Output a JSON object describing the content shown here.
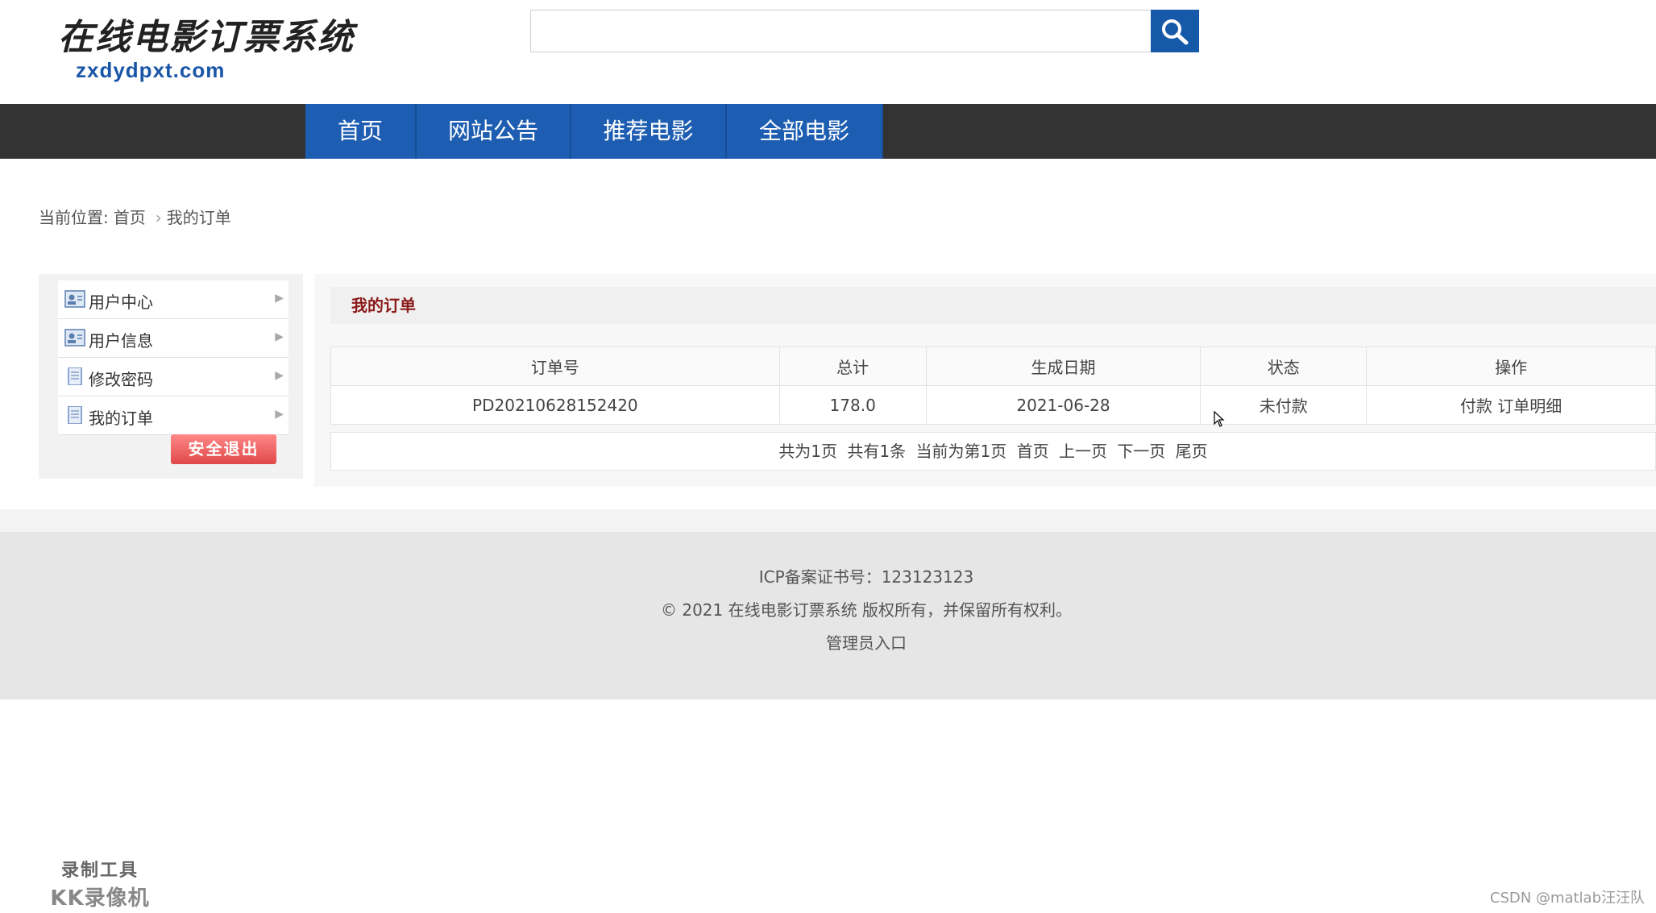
{
  "header": {
    "logo_cn": "在线电影订票系统",
    "logo_en": "zxdydpxt.com",
    "search": {
      "placeholder": "",
      "value": ""
    }
  },
  "nav": {
    "items": [
      "首页",
      "网站公告",
      "推荐电影",
      "全部电影"
    ]
  },
  "breadcrumb": {
    "prefix": "当前位置:",
    "home": "首页",
    "current": "我的订单"
  },
  "sidebar": {
    "items": [
      {
        "label": "用户中心",
        "icon": "user-card-icon"
      },
      {
        "label": "用户信息",
        "icon": "user-card-icon"
      },
      {
        "label": "修改密码",
        "icon": "document-icon"
      },
      {
        "label": "我的订单",
        "icon": "document-icon"
      }
    ],
    "logout_label": "安全退出"
  },
  "main": {
    "title": "我的订单",
    "table": {
      "headers": [
        "订单号",
        "总计",
        "生成日期",
        "状态",
        "操作"
      ],
      "rows": [
        {
          "order_no": "PD20210628152420",
          "total": "178.0",
          "date": "2021-06-28",
          "status": "未付款",
          "op_pay": "付款",
          "op_detail": "订单明细"
        }
      ]
    },
    "pager": {
      "total_pages": "共为1页",
      "total_items": "共有1条",
      "current": "当前为第1页",
      "first": "首页",
      "prev": "上一页",
      "next": "下一页",
      "last": "尾页"
    }
  },
  "footer": {
    "icp": "ICP备案证书号：123123123",
    "copyright": "© 2021 在线电影订票系统 版权所有，并保留所有权利。",
    "admin": "管理员入口"
  },
  "watermarks": {
    "left_line1": "录制工具",
    "left_line2": "KK录像机",
    "right": "CSDN @matlab汪汪队"
  },
  "colors": {
    "nav_bg": "#333333",
    "nav_item_bg": "#1e5eb2",
    "search_btn": "#1559a8",
    "title_red": "#8b1a1a",
    "logout_red": "#e04848",
    "footer_bg": "#e6e6e6"
  }
}
